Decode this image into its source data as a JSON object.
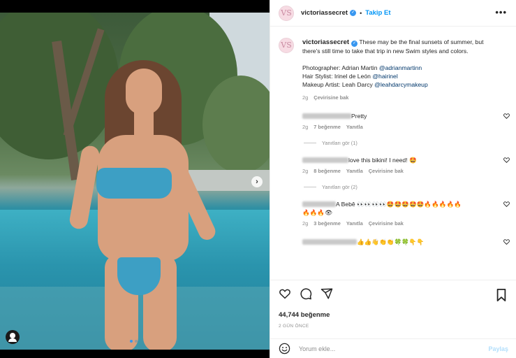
{
  "header": {
    "username": "victoriassecret",
    "separator": "•",
    "follow_label": "Takip Et",
    "more_label": "•••",
    "avatar_monogram": "VS"
  },
  "caption": {
    "username": "victoriassecret",
    "line1": "These may be the final sunsets of summer, but there's still time to take that trip in new Swim styles and colors.",
    "credits": [
      {
        "role": "Photographer: Adrian Martin ",
        "handle": "@adrianmartinn"
      },
      {
        "role": "Hair Stylist: Irinel de León ",
        "handle": "@hairinel"
      },
      {
        "role": "Makeup Artist: Leah Darcy ",
        "handle": "@leahdarcymakeup"
      }
    ],
    "age": "2g",
    "translate_label": "Çevirisine bak"
  },
  "comments": [
    {
      "text": "Pretty",
      "age": "2g",
      "likes": "7 beğenme",
      "reply_label": "Yanıtla",
      "translate_label": "",
      "view_replies": "Yanıtları gör (1)"
    },
    {
      "text": "love this bikini! I need! 🤩",
      "age": "2g",
      "likes": "8 beğenme",
      "reply_label": "Yanıtla",
      "translate_label": "Çevirisine bak",
      "view_replies": "Yanıtları gör (2)"
    },
    {
      "text": "A Bebê 👀👀👀👀🤩🤩🤩🤩🤩🔥🔥🔥🔥🔥",
      "text2": "🔥🔥🔥👁",
      "age": "2g",
      "likes": "3 beğenme",
      "reply_label": "Yanıtla",
      "translate_label": "Çevirisine bak"
    },
    {
      "text": "👍👍👋👏👏🍀🍀👇👇"
    }
  ],
  "actions": {
    "like_count": "44,744 beğenme",
    "posted": "2 GÜN ÖNCE"
  },
  "composer": {
    "placeholder": "Yorum ekle...",
    "post_label": "Paylaş"
  },
  "colors": {
    "accent": "#0095f6",
    "verified": "#3897f0",
    "muted": "#8e8e8e"
  },
  "carousel": {
    "current": 1,
    "total": 2
  }
}
